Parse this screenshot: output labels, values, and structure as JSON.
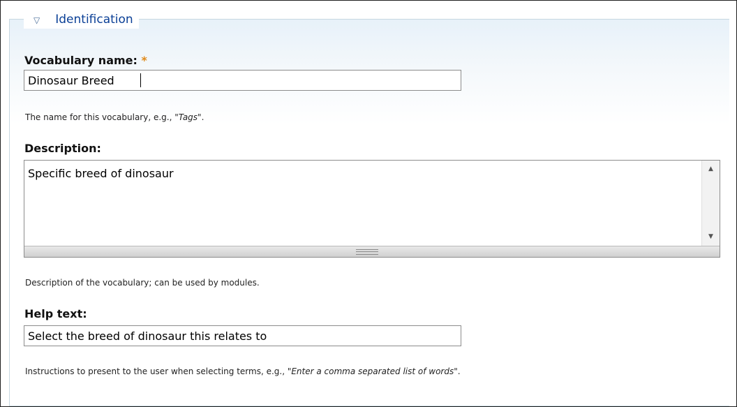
{
  "fieldset": {
    "legend": "Identification",
    "toggle_icon": "triangle-down-icon"
  },
  "vocabulary_name": {
    "label": "Vocabulary name:",
    "required_marker": "*",
    "value": "Dinosaur Breed",
    "description_prefix": "The name for this vocabulary, e.g., ",
    "description_example": "\"Tags\"",
    "description_suffix": "."
  },
  "description": {
    "label": "Description:",
    "value": "Specific breed of dinosaur",
    "description": "Description of the vocabulary; can be used by modules."
  },
  "help_text": {
    "label": "Help text:",
    "value": "Select the breed of dinosaur this relates to",
    "description_prefix": "Instructions to present to the user when selecting terms, e.g., ",
    "description_example": "\"Enter a comma separated list of words\"",
    "description_suffix": "."
  },
  "colors": {
    "legend": "#0a3f96",
    "required": "#e08a1a",
    "fieldset_border": "#c7d7e0"
  }
}
